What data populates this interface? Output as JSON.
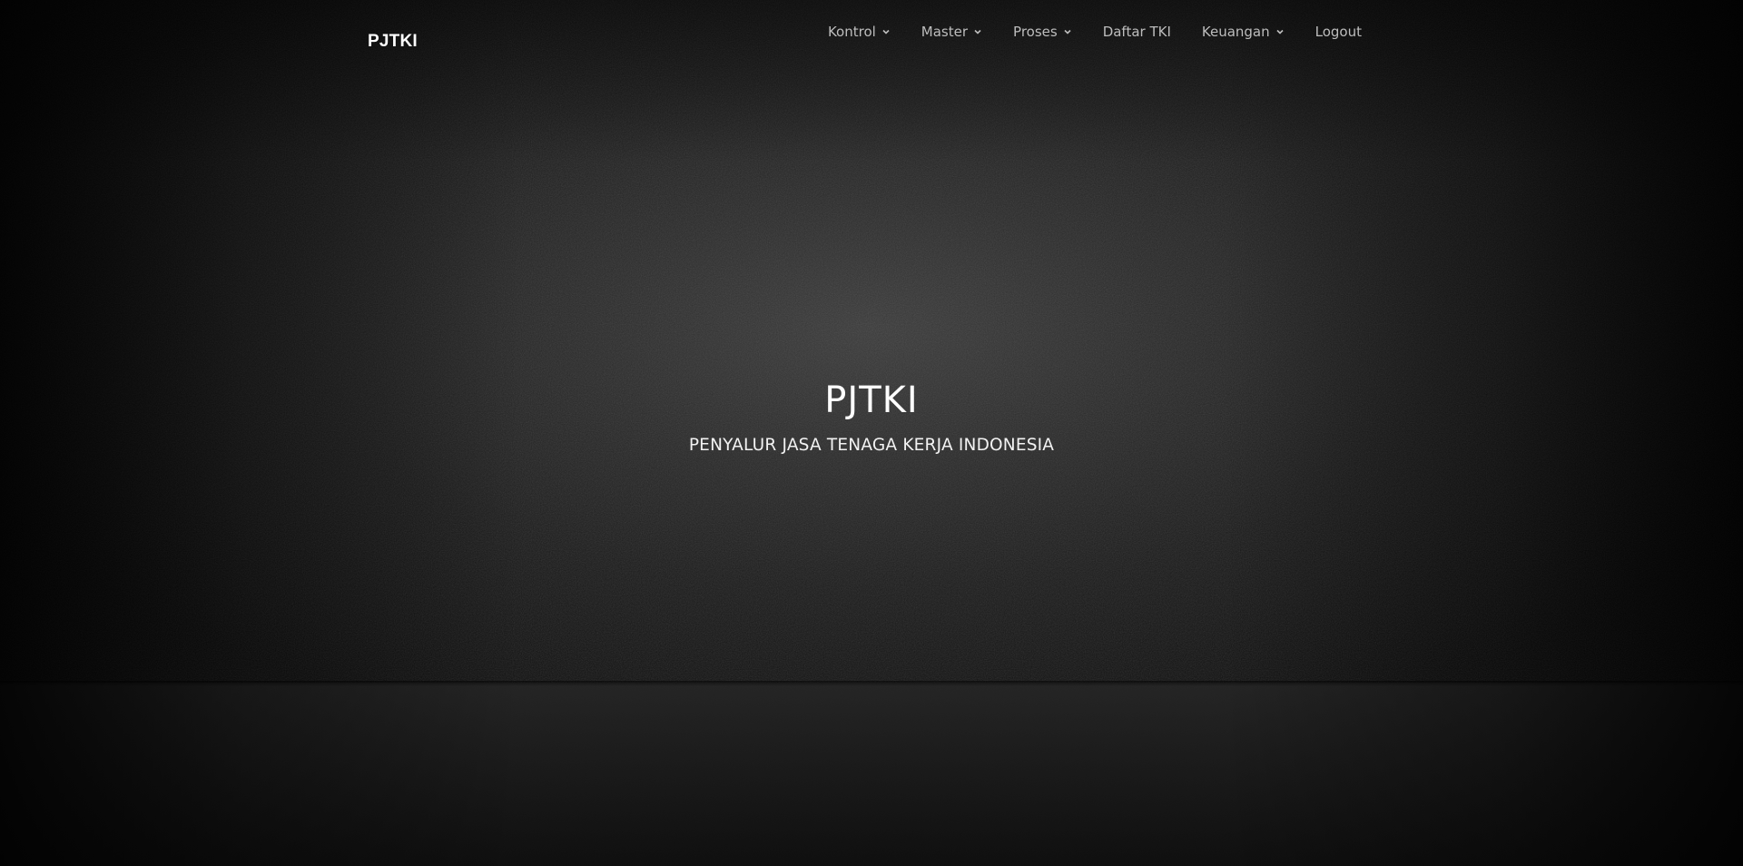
{
  "navbar": {
    "brand": "PJTKI",
    "items": [
      {
        "label": "Kontrol",
        "icon": "chevron-down-icon",
        "dropdown": true
      },
      {
        "label": "Master",
        "icon": "chevron-down-icon",
        "dropdown": true
      },
      {
        "label": "Proses",
        "icon": "chevron-down-icon",
        "dropdown": true
      },
      {
        "label": "Daftar TKI",
        "dropdown": false
      },
      {
        "label": "Keuangan",
        "icon": "chevron-down-icon",
        "dropdown": true
      },
      {
        "label": "Logout",
        "dropdown": false
      }
    ]
  },
  "hero": {
    "title": "PJTKI",
    "subtitle": "PENYALUR JASA TENAGA KERJA INDONESIA"
  },
  "colors": {
    "background": "#0a0a0a",
    "text_primary": "#ffffff",
    "nav_text": "#bdbdbd"
  }
}
